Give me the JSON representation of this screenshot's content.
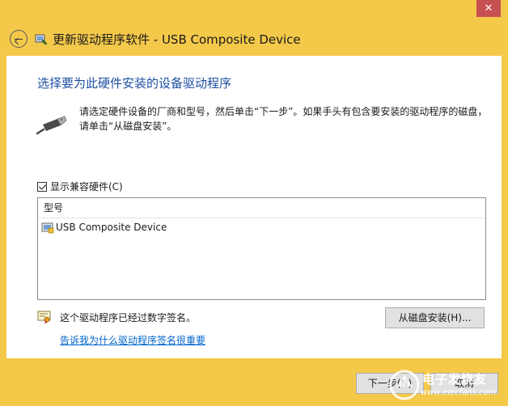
{
  "window": {
    "title": "更新驱动程序软件 - USB Composite Device",
    "close_label": "✕"
  },
  "main": {
    "heading": "选择要为此硬件安装的设备驱动程序",
    "instruction": "请选定硬件设备的厂商和型号，然后单击“下一步”。如果手头有包含要安装的驱动程序的磁盘，请单击“从磁盘安装”。",
    "compat_checkbox": {
      "label": "显示兼容硬件(C)",
      "checked": true
    },
    "list": {
      "header": "型号",
      "items": [
        "USB Composite Device"
      ]
    },
    "signature_text": "这个驱动程序已经过数字签名。",
    "signature_link": "告诉我为什么驱动程序签名很重要",
    "have_disk_label": "从磁盘安装(H)..."
  },
  "footer": {
    "next_label": "下一步(N)",
    "cancel_label": "取消"
  },
  "watermark": {
    "text": "电子发烧友",
    "url": "www.elecfans.com"
  },
  "colors": {
    "titlebar_bg": "#f4c94a",
    "heading": "#1e50a2",
    "link": "#0066cc",
    "close_btn": "#c75050"
  },
  "icons": {
    "back": "back-arrow-icon",
    "wizard": "device-wizard-icon",
    "usb": "usb-plug-icon",
    "list_item": "device-driver-icon",
    "signature": "signed-certificate-icon"
  }
}
